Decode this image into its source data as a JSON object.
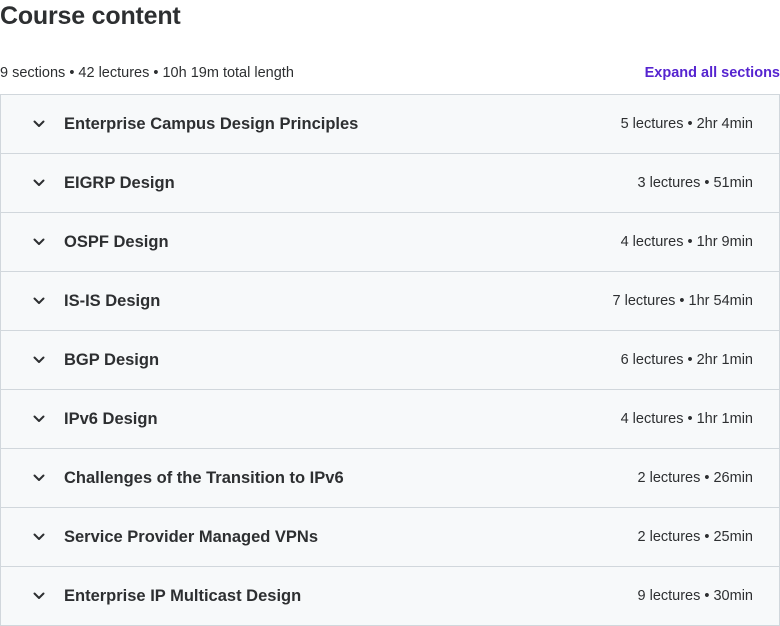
{
  "header": {
    "title": "Course content",
    "summary": "9 sections • 42 lectures • 10h 19m total length",
    "expand_all_label": "Expand all sections"
  },
  "sections": [
    {
      "title": "Enterprise Campus Design Principles",
      "meta": "5 lectures • 2hr 4min"
    },
    {
      "title": "EIGRP Design",
      "meta": "3 lectures • 51min"
    },
    {
      "title": "OSPF Design",
      "meta": "4 lectures • 1hr 9min"
    },
    {
      "title": "IS-IS Design",
      "meta": "7 lectures • 1hr 54min"
    },
    {
      "title": "BGP Design",
      "meta": "6 lectures • 2hr 1min"
    },
    {
      "title": "IPv6 Design",
      "meta": "4 lectures • 1hr 1min"
    },
    {
      "title": "Challenges of the Transition to IPv6",
      "meta": "2 lectures • 26min"
    },
    {
      "title": "Service Provider Managed VPNs",
      "meta": "2 lectures • 25min"
    },
    {
      "title": "Enterprise IP Multicast Design",
      "meta": "9 lectures • 30min"
    }
  ],
  "icons": {
    "section_toggle": "chevron-down-icon"
  },
  "colors": {
    "accent": "#5624d0",
    "text": "#2d2f31",
    "section_bg": "#f7f9fa",
    "border": "#d1d7dc"
  }
}
